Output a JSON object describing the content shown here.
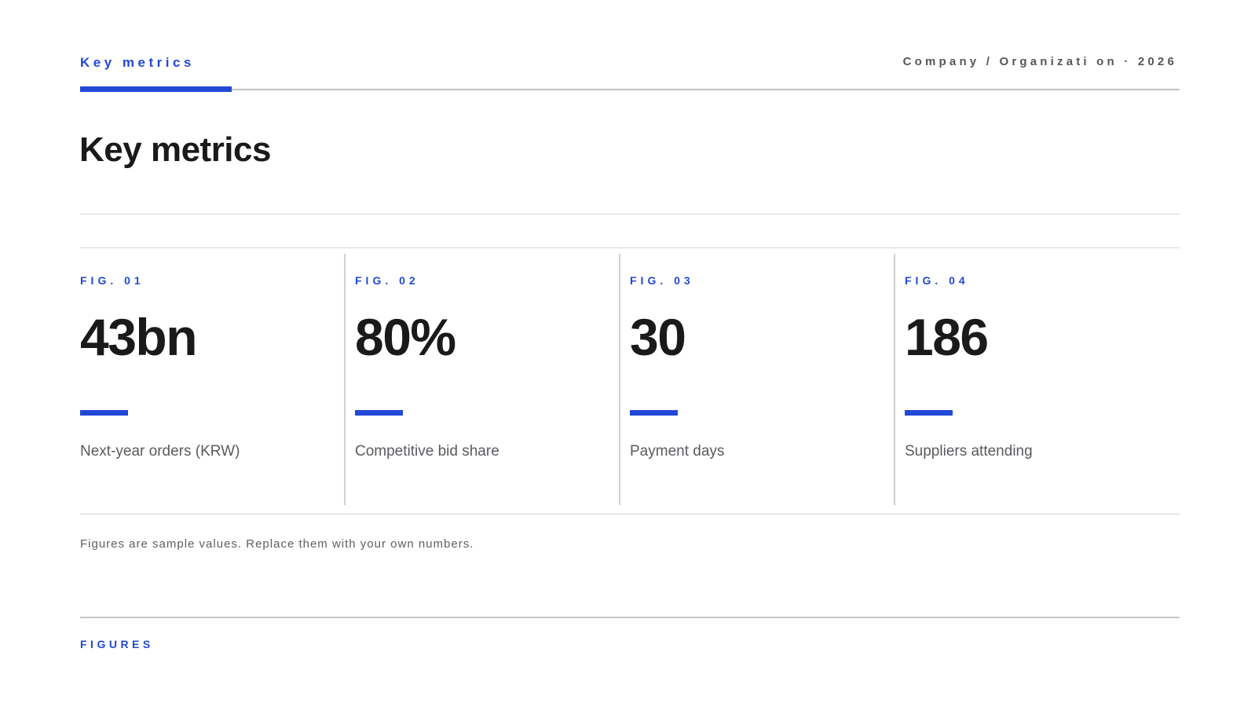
{
  "header": {
    "eyebrow": "Key metrics",
    "company": "Company / Organizati on · 2026"
  },
  "title": "Key metrics",
  "metrics": [
    {
      "fig": "FIG. 01",
      "value": "43bn",
      "label": "Next-year orders (KRW)"
    },
    {
      "fig": "FIG. 02",
      "value": "80%",
      "label": "Competitive bid share"
    },
    {
      "fig": "FIG. 03",
      "value": "30",
      "label": "Payment days"
    },
    {
      "fig": "FIG. 04",
      "value": "186",
      "label": "Suppliers attending"
    }
  ],
  "footnote": "Figures are sample values. Replace them with your own numbers.",
  "footer_label": "FIGURES",
  "colors": {
    "accent": "#2149d6",
    "text": "#1a1a1a",
    "muted": "#5a5b5f"
  }
}
